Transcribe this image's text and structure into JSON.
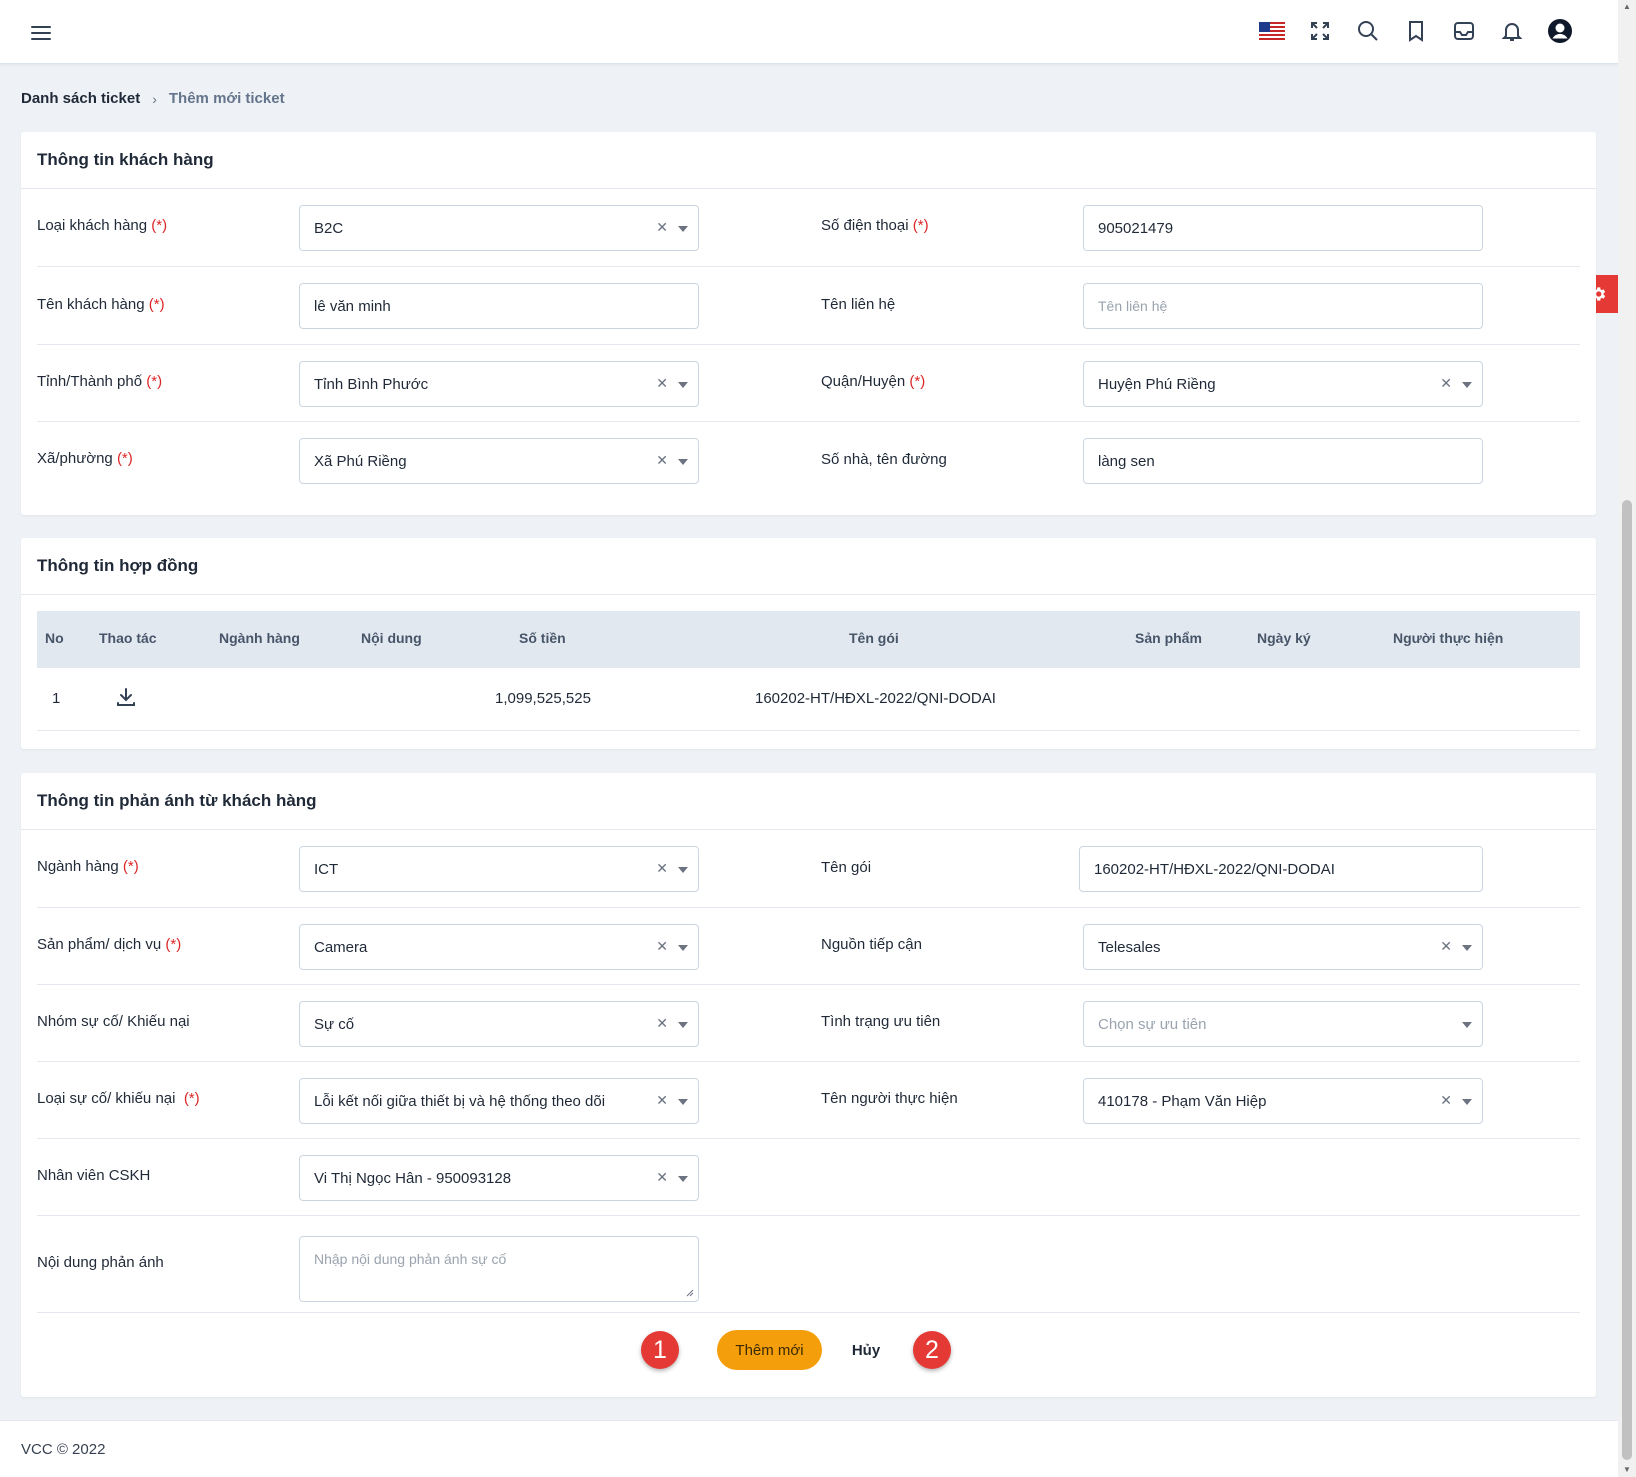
{
  "header": {
    "icons": [
      "menu-icon",
      "us-flag-icon",
      "fullscreen-icon",
      "search-icon",
      "bookmark-icon",
      "inbox-icon",
      "bell-icon",
      "user-icon"
    ]
  },
  "breadcrumb": {
    "parent": "Danh sách ticket",
    "separator": "›",
    "current": "Thêm mới ticket"
  },
  "customer": {
    "title": "Thông tin khách hàng",
    "required_mark": "(*)",
    "customer_type_label": "Loại khách hàng",
    "customer_type_value": "B2C",
    "phone_label": "Số điện thoại",
    "phone_value": "905021479",
    "customer_name_label": "Tên khách hàng",
    "customer_name_value": "lê văn minh",
    "contact_name_label": "Tên liên hệ",
    "contact_name_placeholder": "Tên liên hệ",
    "province_label": "Tỉnh/Thành phố",
    "province_value": "Tỉnh Bình Phước",
    "district_label": "Quận/Huyện",
    "district_value": "Huyện Phú Riềng",
    "ward_label": "Xã/phường",
    "ward_value": "Xã Phú Riềng",
    "address_label": "Số nhà, tên đường",
    "address_value": "làng sen"
  },
  "contract": {
    "title": "Thông tin hợp đồng",
    "columns": [
      "No",
      "Thao tác",
      "Ngành hàng",
      "Nội dung",
      "Số tiền",
      "Tên gói",
      "Sản phẩm",
      "Ngày ký",
      "Người thực hiện"
    ],
    "rows": [
      {
        "no": "1",
        "action_icon": "download-icon",
        "industry": "",
        "content": "",
        "amount": "1,099,525,525",
        "package": "160202-HT/HĐXL-2022/QNI-DODAI",
        "product": "",
        "sign_date": "",
        "performer": ""
      }
    ]
  },
  "feedback": {
    "title": "Thông tin phản ánh từ khách hàng",
    "industry_label": "Ngành hàng",
    "industry_value": "ICT",
    "package_label": "Tên gói",
    "package_value": "160202-HT/HĐXL-2022/QNI-DODAI",
    "product_label": "Sản phẩm/ dịch vụ",
    "product_value": "Camera",
    "source_label": "Nguồn tiếp cận",
    "source_value": "Telesales",
    "group_label": "Nhóm sự cố/ Khiếu nại",
    "group_value": "Sự cố",
    "priority_label": "Tình trạng ưu tiên",
    "priority_placeholder": "Chọn sự ưu tiên",
    "issue_type_label": "Loại sự cố/ khiếu nại",
    "issue_type_value": "Lỗi kết nối giữa thiết bị và hệ thống theo dõi",
    "performer_label": "Tên người thực hiện",
    "performer_value": "410178 - Phạm Văn Hiệp",
    "staff_label": "Nhân viên CSKH",
    "staff_value": "Vi Thị Ngọc Hân - 950093128",
    "content_label": "Nội dung phản ánh",
    "content_placeholder": "Nhập nội dung phản ánh sự cố"
  },
  "actions": {
    "submit_label": "Thêm mới",
    "cancel_label": "Hủy",
    "badge_1": "1",
    "badge_2": "2"
  },
  "footer": {
    "text": "VCC © 2022"
  },
  "colors": {
    "accent": "#f59e0b",
    "required": "#dc2626",
    "badge": "#e53935",
    "table_header_bg": "#e2e8f0"
  }
}
